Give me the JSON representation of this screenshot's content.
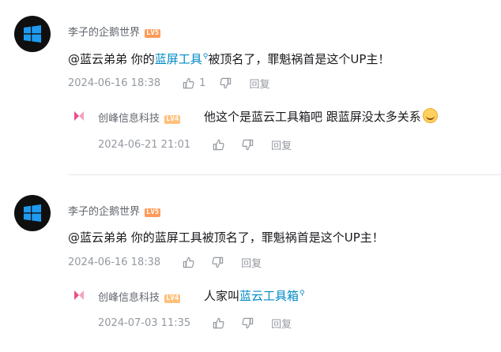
{
  "comments": [
    {
      "username": "李子的企鹅世界",
      "level": "LV5",
      "text_prefix": "@蓝云弟弟 你的",
      "link_text": "蓝屏工具",
      "text_suffix": "被顶名了，罪魁祸首是这个UP主！",
      "date": "2024-06-16 18:38",
      "likes": "1",
      "reply_label": "回复",
      "reply": {
        "username": "创峰信息科技",
        "level": "LV4",
        "text": "他这个是蓝云工具箱吧 跟蓝屏没太多关系",
        "date": "2024-06-21 21:01",
        "reply_label": "回复"
      }
    },
    {
      "username": "李子的企鹅世界",
      "level": "LV5",
      "text": "@蓝云弟弟 你的蓝屏工具被顶名了，罪魁祸首是这个UP主！",
      "date": "2024-06-16 18:38",
      "reply_label": "回复",
      "reply": {
        "username": "创峰信息科技",
        "level": "LV4",
        "text_prefix": "人家叫",
        "link_text": "蓝云工具箱",
        "date": "2024-07-03 11:35",
        "reply_label": "回复"
      }
    }
  ],
  "icons": [
    "windows-logo-icon",
    "search-icon",
    "thumbs-up-icon",
    "thumbs-down-icon",
    "emoji-icon"
  ],
  "colors": {
    "link": "#008ac5",
    "meta": "#9499a0",
    "level5": "#ff9a56",
    "level4": "#ffc07a",
    "avatar": "#0f0f0f"
  }
}
